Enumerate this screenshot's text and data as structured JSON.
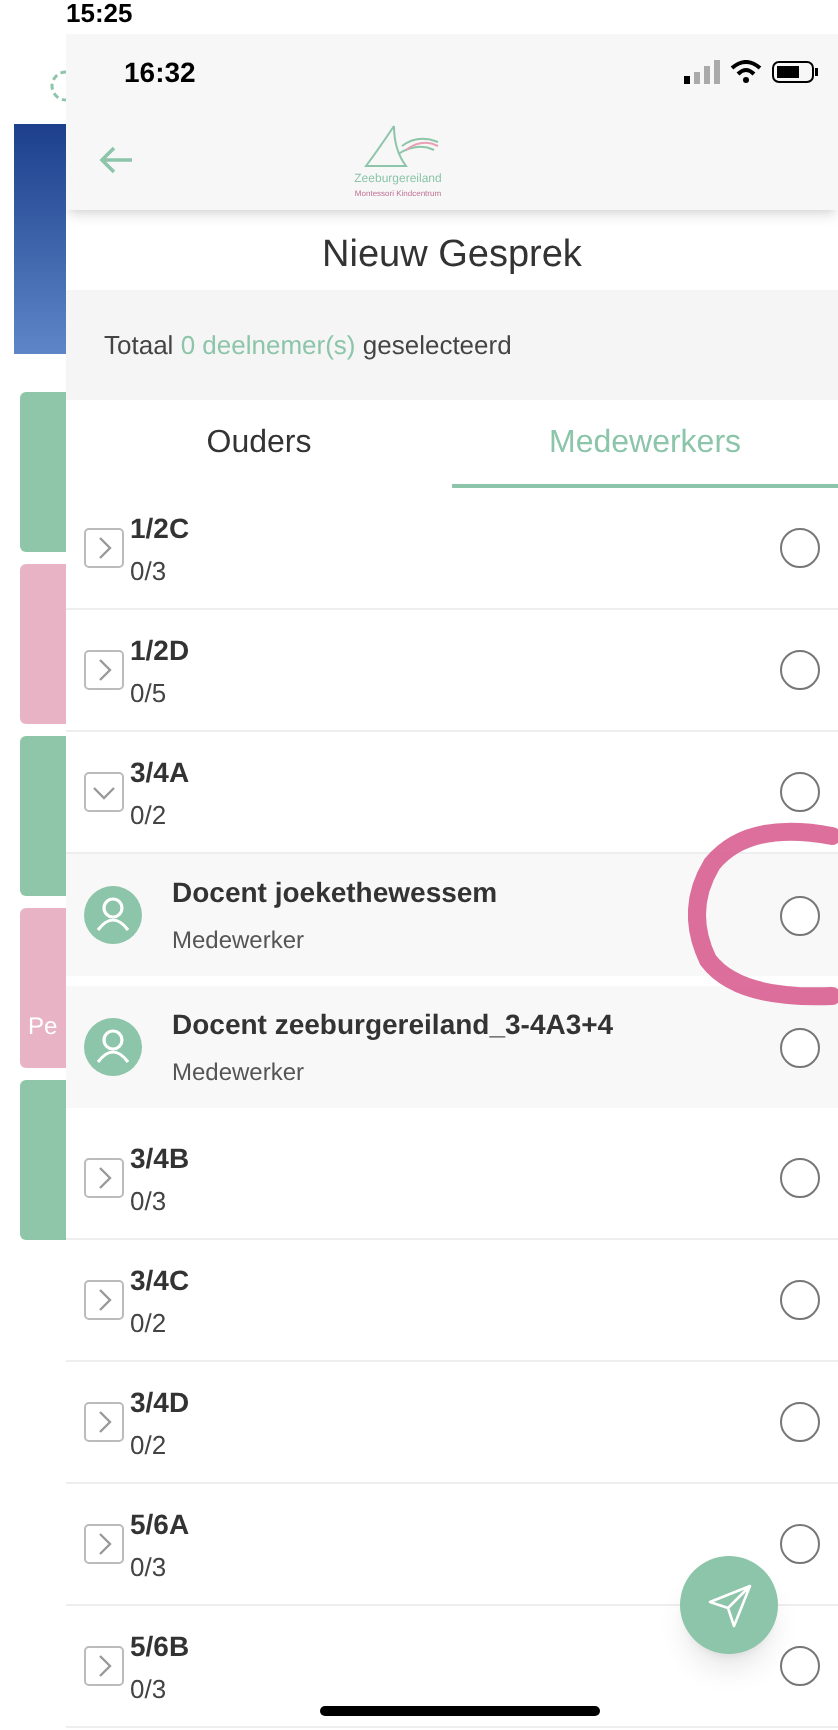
{
  "background_screen": {
    "time": "15:25",
    "tiles": [
      {
        "color": "#8fc5a9"
      },
      {
        "color": "#e8b4c5"
      },
      {
        "color": "#8fc5a9"
      },
      {
        "color": "#e8b4c5",
        "label": "Pe"
      },
      {
        "color": "#8fc5a9"
      }
    ]
  },
  "status_bar": {
    "time": "16:32"
  },
  "header": {
    "logo_name": "Zeeburgereiland",
    "logo_subtitle": "Montessori Kindcentrum"
  },
  "title": "Nieuw Gesprek",
  "summary": {
    "prefix": "Totaal",
    "count": "0 deelnemer(s)",
    "suffix": "geselecteerd"
  },
  "tabs": [
    {
      "label": "Ouders",
      "selected": false
    },
    {
      "label": "Medewerkers",
      "selected": true
    }
  ],
  "groups": [
    {
      "name": "1/2C",
      "count": "0/3",
      "expanded": false,
      "selected": false
    },
    {
      "name": "1/2D",
      "count": "0/5",
      "expanded": false,
      "selected": false
    },
    {
      "name": "3/4A",
      "count": "0/2",
      "expanded": true,
      "selected": false,
      "children": [
        {
          "name": "Docent joekethewessem",
          "role": "Medewerker",
          "selected": false
        },
        {
          "name": "Docent zeeburgereiland_3-4A3+4",
          "role": "Medewerker",
          "selected": false
        }
      ]
    },
    {
      "name": "3/4B",
      "count": "0/3",
      "expanded": false,
      "selected": false
    },
    {
      "name": "3/4C",
      "count": "0/2",
      "expanded": false,
      "selected": false
    },
    {
      "name": "3/4D",
      "count": "0/2",
      "expanded": false,
      "selected": false
    },
    {
      "name": "5/6A",
      "count": "0/3",
      "expanded": false,
      "selected": false
    },
    {
      "name": "5/6B",
      "count": "0/3",
      "expanded": false,
      "selected": false
    }
  ]
}
